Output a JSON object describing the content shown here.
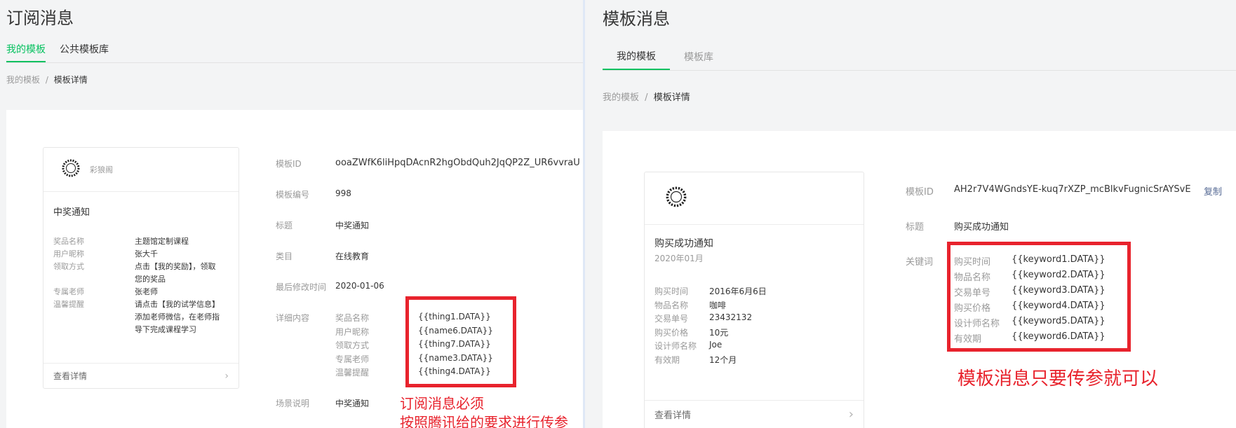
{
  "left": {
    "title": "订阅消息",
    "tabs": [
      {
        "label": "我的模板",
        "active": true
      },
      {
        "label": "公共模板库",
        "active": false
      }
    ],
    "breadcrumb": {
      "parent": "我的模板",
      "sep": "/",
      "current": "模板详情"
    },
    "card": {
      "brand": "彩狼阁",
      "heading": "中奖通知",
      "rows": [
        {
          "label": "奖品名称",
          "value": "主题馆定制课程"
        },
        {
          "label": "用户昵称",
          "value": "张大千"
        },
        {
          "label": "领取方式",
          "value": "点击【我的奖励】，领取"
        },
        {
          "label": "",
          "value": "您的奖品"
        },
        {
          "label": "专属老师",
          "value": "张老师"
        },
        {
          "label": "温馨提醒",
          "value": "请点击【我的试学信息】"
        },
        {
          "label": "",
          "value": "添加老师微信，在老师指"
        },
        {
          "label": "",
          "value": "导下完成课程学习"
        }
      ],
      "footer": "查看详情"
    },
    "details": {
      "template_id_label": "模板ID",
      "template_id": "ooaZWfK6liHpqDAcnR2hgObdQuh2JqQP2Z_UR6vvraU",
      "number_label": "模板编号",
      "number": "998",
      "title_label": "标题",
      "title": "中奖通知",
      "category_label": "类目",
      "category": "在线教育",
      "modified_label": "最后修改时间",
      "modified": "2020-01-06",
      "content_label": "详细内容",
      "content": [
        {
          "label": "奖品名称",
          "value": "{{thing1.DATA}}"
        },
        {
          "label": "用户昵称",
          "value": "{{name6.DATA}}"
        },
        {
          "label": "领取方式",
          "value": "{{thing7.DATA}}"
        },
        {
          "label": "专属老师",
          "value": "{{name3.DATA}}"
        },
        {
          "label": "温馨提醒",
          "value": "{{thing4.DATA}}"
        }
      ],
      "scene_label": "场景说明",
      "scene": "中奖通知"
    },
    "note_line1": "订阅消息必须",
    "note_line2": "按照腾讯给的要求进行传参"
  },
  "right": {
    "title": "模板消息",
    "tabs": [
      {
        "label": "我的模板",
        "active": true
      },
      {
        "label": "模板库",
        "active": false
      }
    ],
    "breadcrumb": {
      "parent": "我的模板",
      "sep": "/",
      "current": "模板详情"
    },
    "card": {
      "heading": "购买成功通知",
      "date": "2020年01月",
      "rows": [
        {
          "label": "购买时间",
          "value": "2016年6月6日"
        },
        {
          "label": "物品名称",
          "value": "咖啡"
        },
        {
          "label": "交易单号",
          "value": "23432132"
        },
        {
          "label": "购买价格",
          "value": "10元"
        },
        {
          "label": "设计师名称",
          "value": "Joe"
        },
        {
          "label": "有效期",
          "value": "12个月"
        }
      ],
      "footer": "查看详情"
    },
    "details": {
      "template_id_label": "模板ID",
      "template_id": "AH2r7V4WGndsYE-kuq7rXZP_mcBlkvFugnicSrAYSvE",
      "copy_label": "复制",
      "title_label": "标题",
      "title": "购买成功通知",
      "keywords_label": "关键词",
      "keywords": [
        {
          "label": "购买时间",
          "value": "{{keyword1.DATA}}"
        },
        {
          "label": "物品名称",
          "value": "{{keyword2.DATA}}"
        },
        {
          "label": "交易单号",
          "value": "{{keyword3.DATA}}"
        },
        {
          "label": "购买价格",
          "value": "{{keyword4.DATA}}"
        },
        {
          "label": "设计师名称",
          "value": "{{keyword5.DATA}}"
        },
        {
          "label": "有效期",
          "value": "{{keyword6.DATA}}"
        }
      ]
    },
    "note": "模板消息只要传参就可以"
  },
  "colors": {
    "accent": "#07c160",
    "annotation": "#e8232d",
    "link": "#576b95"
  }
}
